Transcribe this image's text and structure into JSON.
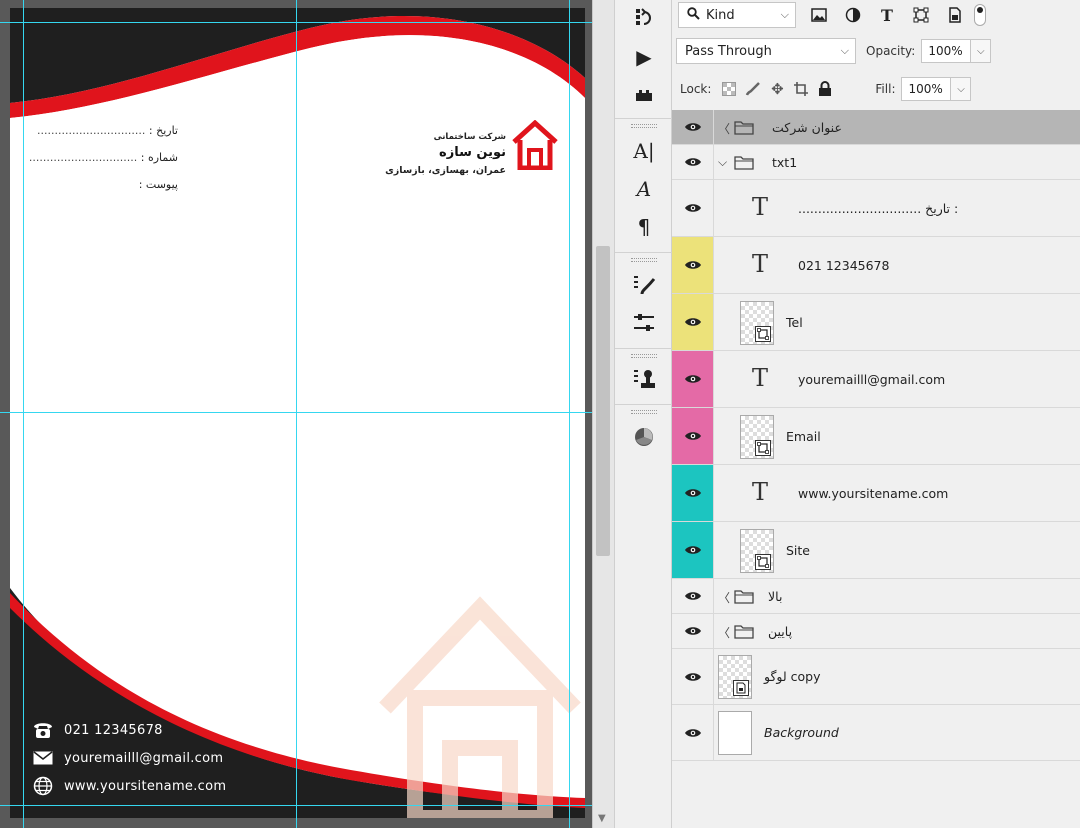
{
  "canvas": {
    "company_small": "شرکت ساختمانی",
    "company_name": "نوین سازه",
    "company_tagline": "عمران، بهسازی، بازسازی",
    "date_label": "تاریخ :",
    "number_label": "شماره :",
    "attachment_label": "پیوست :",
    "dots": "...............................",
    "phone": "021 12345678",
    "email": "youremailll@gmail.com",
    "website": "www.yoursitename.com"
  },
  "options": {
    "filter_kind": "Kind",
    "blend_mode": "Pass Through",
    "opacity_label": "Opacity:",
    "opacity_value": "100%",
    "lock_label": "Lock:",
    "fill_label": "Fill:",
    "fill_value": "100%"
  },
  "layers": [
    {
      "name": "عنوان شرکت",
      "kind": "group",
      "expanded": false,
      "selected": true,
      "indent": 0,
      "color": ""
    },
    {
      "name": "txt1",
      "kind": "group",
      "expanded": true,
      "selected": false,
      "indent": 0,
      "color": ""
    },
    {
      "name": "...............................  تاریخ :",
      "kind": "text",
      "selected": false,
      "indent": 1,
      "color": ""
    },
    {
      "name": "021 12345678",
      "kind": "text",
      "selected": false,
      "indent": 1,
      "color": "#ece27a"
    },
    {
      "name": "Tel",
      "kind": "smart",
      "selected": false,
      "indent": 1,
      "color": "#ece27a"
    },
    {
      "name": "youremailll@gmail.com",
      "kind": "text",
      "selected": false,
      "indent": 1,
      "color": "#e46aa6"
    },
    {
      "name": "Email",
      "kind": "smart",
      "selected": false,
      "indent": 1,
      "color": "#e46aa6"
    },
    {
      "name": "www.yoursitename.com",
      "kind": "text",
      "selected": false,
      "indent": 1,
      "color": "#1cc5c0"
    },
    {
      "name": "Site",
      "kind": "smart",
      "selected": false,
      "indent": 1,
      "color": "#1cc5c0"
    },
    {
      "name": "بالا",
      "kind": "group",
      "expanded": false,
      "selected": false,
      "indent": 0,
      "color": ""
    },
    {
      "name": "پایین",
      "kind": "group",
      "expanded": false,
      "selected": false,
      "indent": 0,
      "color": ""
    },
    {
      "name": "لوگو copy",
      "kind": "smartdoc",
      "selected": false,
      "indent": 0,
      "color": ""
    },
    {
      "name": "Background",
      "kind": "background",
      "selected": false,
      "indent": 0,
      "color": ""
    }
  ],
  "colors": {
    "brand_red": "#e0141c",
    "dark": "#1f1f1f",
    "guide": "#35d7f0",
    "selected_row": "#b5b5b5"
  }
}
